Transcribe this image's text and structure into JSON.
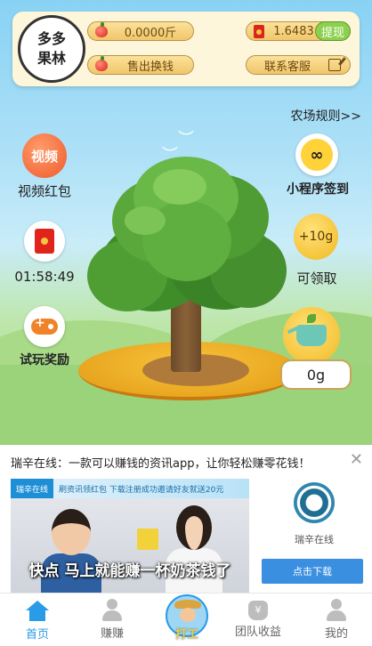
{
  "header": {
    "logo_line1": "多多",
    "logo_line2": "果林",
    "fruit_balance": "0.0000斤",
    "sell_button": "售出换钱",
    "cash_balance": "1.6483",
    "withdraw_button": "提现",
    "support_button": "联系客服"
  },
  "farm": {
    "rules_link": "农场规则>>",
    "video_icon_text": "视频",
    "video_label": "视频红包",
    "countdown": "01:58:49",
    "trial_label": "试玩奖励",
    "mini_program_label": "小程序签到",
    "water_bonus": "+10g",
    "claim_label": "可领取",
    "water_amount": "0g"
  },
  "ad": {
    "title": "瑞辛在线：一款可以赚钱的资讯app，让你轻松赚零花钱！",
    "strip_brand": "瑞辛在线",
    "strip_text": "刷资讯领红包 下载注册成功邀请好友就送20元",
    "caption": "快点 马上就能赚一杯奶茶钱了",
    "app_name": "瑞辛在线",
    "download_button": "点击下载"
  },
  "nav": {
    "items": [
      {
        "label": "首页",
        "icon": "home-icon"
      },
      {
        "label": "赚赚",
        "icon": "person-icon"
      },
      {
        "label": "打工",
        "icon": "farmer-icon"
      },
      {
        "label": "团队收益",
        "icon": "money-bag-icon"
      },
      {
        "label": "我的",
        "icon": "profile-icon"
      }
    ],
    "active": "首页",
    "money_bag_symbol": "¥"
  },
  "colors": {
    "active_tab": "#2a9be6",
    "withdraw": "#8bd04e",
    "download": "#3a8fe0"
  }
}
